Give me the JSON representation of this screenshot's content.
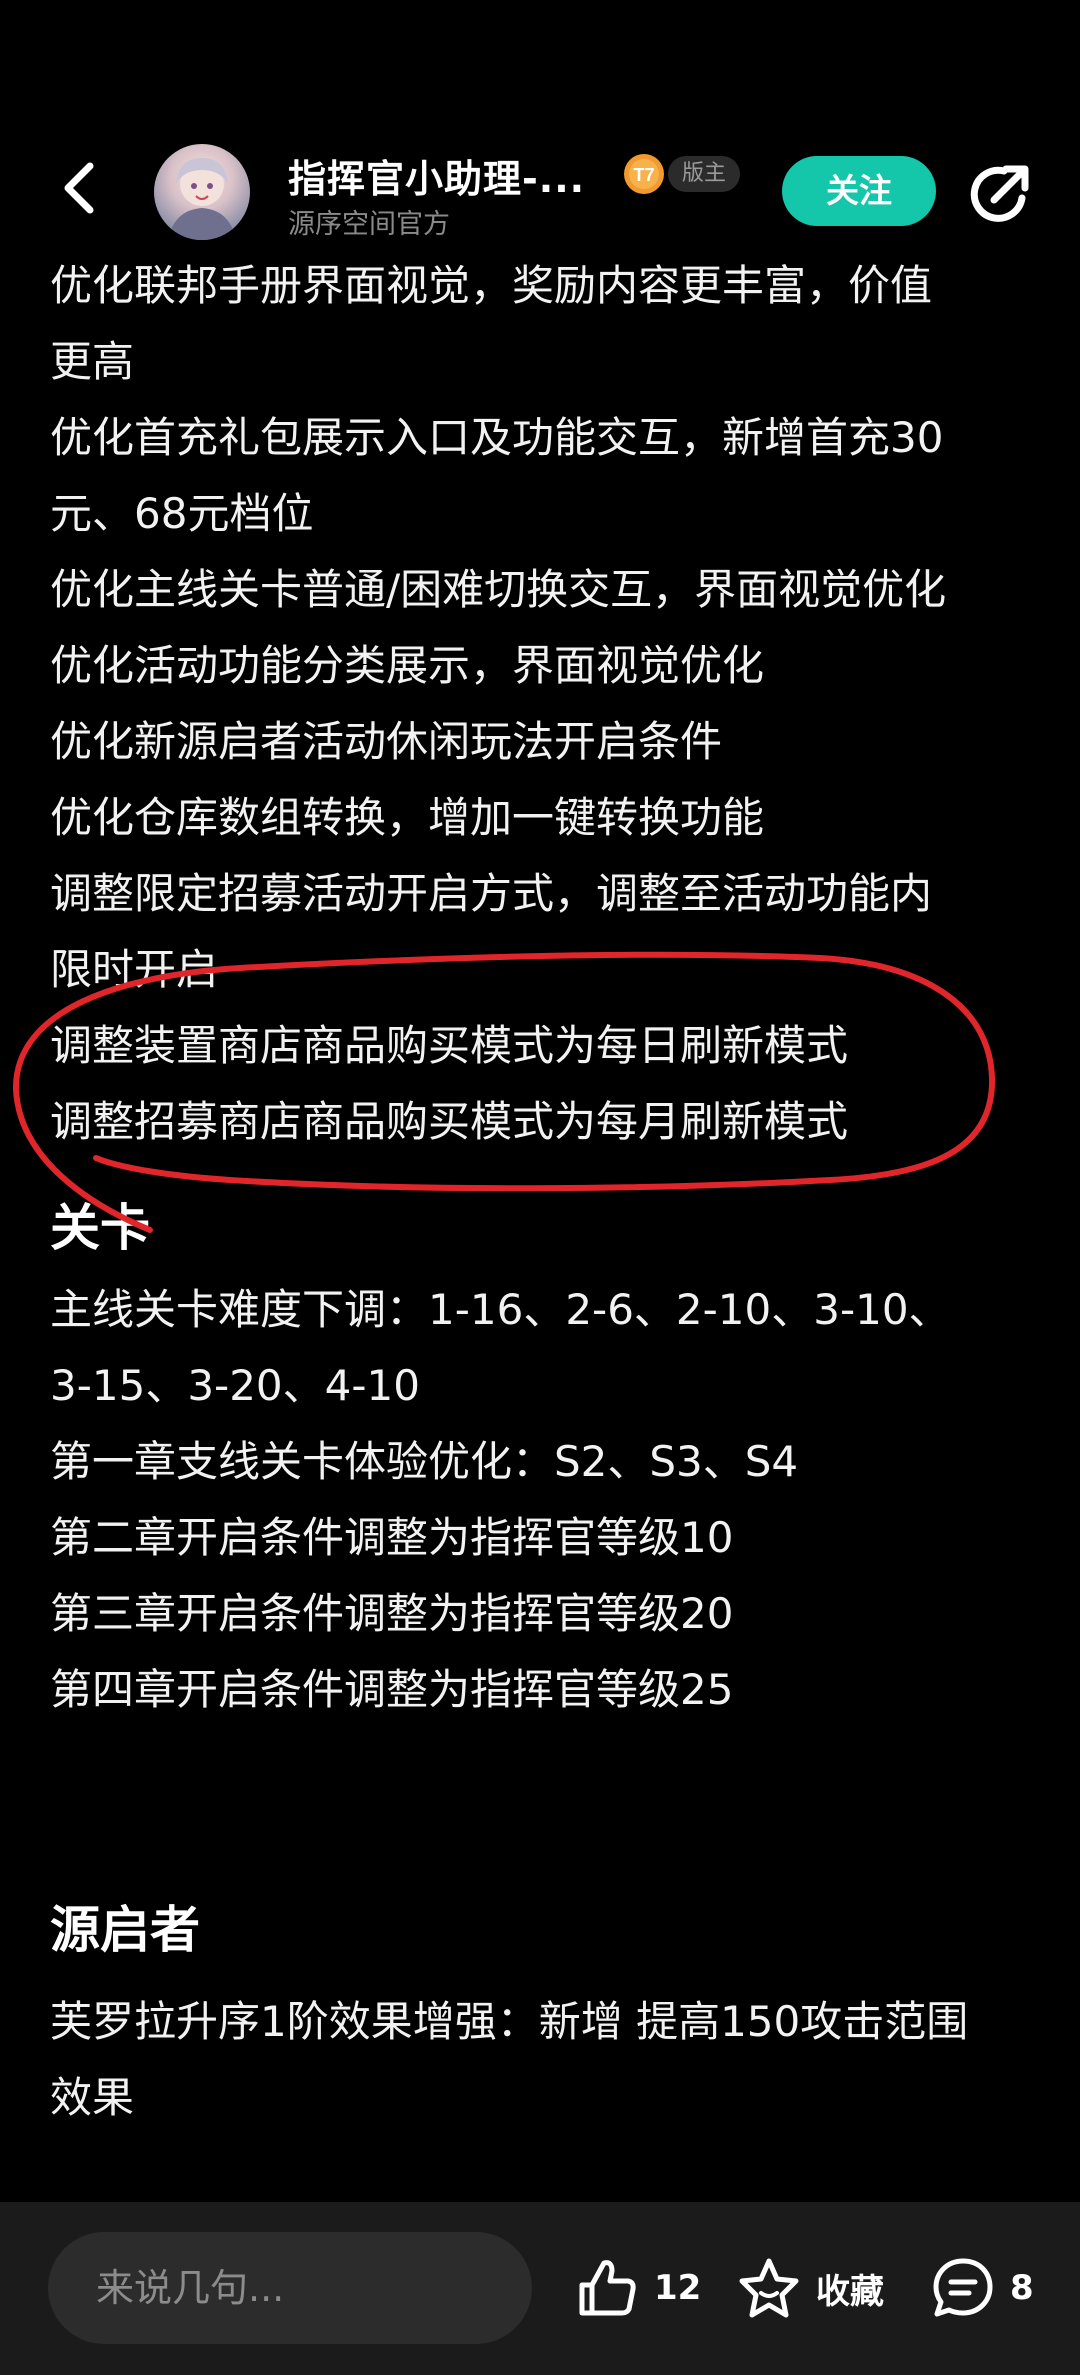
{
  "header": {
    "author_name": "指挥官小助理-...",
    "author_subtitle": "源序空间官方",
    "role_badge": "版主",
    "level_badge_text": "T7",
    "follow_label": "关注"
  },
  "article": {
    "intro_lines": [
      "优化联邦手册界面视觉，奖励内容更丰富，价值",
      "更高",
      "优化首充礼包展示入口及功能交互，新增首充30",
      "元、68元档位",
      "优化主线关卡普通/困难切换交互，界面视觉优化",
      "优化活动功能分类展示，界面视觉优化",
      "优化新源启者活动休闲玩法开启条件",
      "优化仓库数组转换，增加一键转换功能",
      "调整限定招募活动开启方式，调整至活动功能内",
      "限时开启",
      "调整装置商店商品购买模式为每日刷新模式",
      "调整招募商店商品购买模式为每月刷新模式"
    ],
    "sections": [
      {
        "title": "关卡",
        "lines": [
          "主线关卡难度下调：1-16、2-6、2-10、3-10、",
          "3-15、3-20、4-10",
          "第一章支线关卡体验优化：S2、S3、S4",
          "第二章开启条件调整为指挥官等级10",
          "第三章开启条件调整为指挥官等级20",
          "第四章开启条件调整为指挥官等级25"
        ]
      },
      {
        "title": "源启者",
        "lines": [
          "芙罗拉升序1阶效果增强：新增 提高150攻击范围",
          "效果"
        ]
      }
    ]
  },
  "bottom_bar": {
    "comment_placeholder": "来说几句...",
    "like_count": "12",
    "collect_label": "收藏",
    "comment_count": "8"
  },
  "colors": {
    "background": "#000000",
    "accent": "#14c6aa",
    "annotation": "#e0262b",
    "bottom_bar": "#1b1b1b"
  },
  "icons": {
    "back": "chevron-left-icon",
    "share": "share-icon",
    "like": "thumbs-up-icon",
    "collect": "star-icon",
    "comment": "comment-bubble-icon"
  }
}
